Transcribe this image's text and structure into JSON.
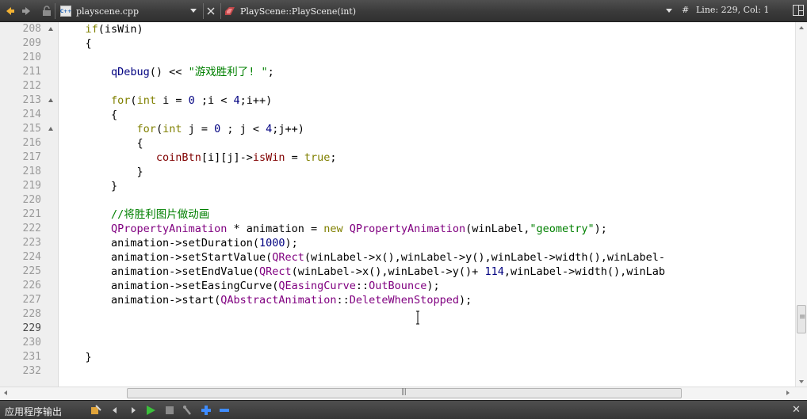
{
  "toolbar": {
    "file_name": "playscene.cpp",
    "file_badge": "C++",
    "symbol_name": "PlayScene::PlayScene(int)",
    "hash": "#",
    "line_col": "Line: 229, Col: 1"
  },
  "editor": {
    "lines": [
      {
        "n": "208",
        "fold": true,
        "html": "    <span class='kw'>if</span><span class='plain'>(isWin)</span>"
      },
      {
        "n": "209",
        "fold": false,
        "html": "    <span class='plain'>{</span>"
      },
      {
        "n": "210",
        "fold": false,
        "html": ""
      },
      {
        "n": "211",
        "fold": false,
        "html": "        qDebug<span class='plain'>() &lt;&lt; </span><span class='str'>\"游戏胜利了! \"</span><span class='plain'>;</span>"
      },
      {
        "n": "212",
        "fold": false,
        "html": ""
      },
      {
        "n": "213",
        "fold": true,
        "html": "        <span class='kw'>for</span><span class='plain'>(</span><span class='kw'>int</span><span class='plain'> i = </span><span class='num'>0</span><span class='plain'> ;i &lt; </span><span class='num'>4</span><span class='plain'>;i++)</span>"
      },
      {
        "n": "214",
        "fold": false,
        "html": "        <span class='plain'>{</span>"
      },
      {
        "n": "215",
        "fold": true,
        "html": "            <span class='kw'>for</span><span class='plain'>(</span><span class='kw'>int</span><span class='plain'> j = </span><span class='num'>0</span><span class='plain'> ; j &lt; </span><span class='num'>4</span><span class='plain'>;j++)</span>"
      },
      {
        "n": "216",
        "fold": false,
        "html": "            <span class='plain'>{</span>"
      },
      {
        "n": "217",
        "fold": false,
        "html": "               <span class='var'>coinBtn</span><span class='plain'>[i][j]-&gt;</span><span class='var'>isWin</span><span class='plain'> = </span><span class='kw'>true</span><span class='plain'>;</span>"
      },
      {
        "n": "218",
        "fold": false,
        "html": "            <span class='plain'>}</span>"
      },
      {
        "n": "219",
        "fold": false,
        "html": "        <span class='plain'>}</span>"
      },
      {
        "n": "220",
        "fold": false,
        "html": ""
      },
      {
        "n": "221",
        "fold": false,
        "html": "        <span class='cm'>//将胜利图片做动画</span>"
      },
      {
        "n": "222",
        "fold": false,
        "html": "        <span class='ty'>QPropertyAnimation</span><span class='plain'> * animation = </span><span class='kw'>new</span> <span class='ty'>QPropertyAnimation</span><span class='plain'>(winLabel,</span><span class='str'>\"geometry\"</span><span class='plain'>);</span>"
      },
      {
        "n": "223",
        "fold": false,
        "html": "        <span class='plain'>animation-&gt;setDuration(</span><span class='num'>1000</span><span class='plain'>);</span>"
      },
      {
        "n": "224",
        "fold": false,
        "html": "        <span class='plain'>animation-&gt;setStartValue(</span><span class='ty'>QRect</span><span class='plain'>(winLabel-&gt;x(),winLabel-&gt;y(),winLabel-&gt;width(),winLabel-</span>"
      },
      {
        "n": "225",
        "fold": false,
        "html": "        <span class='plain'>animation-&gt;setEndValue(</span><span class='ty'>QRect</span><span class='plain'>(winLabel-&gt;x(),winLabel-&gt;y()+ </span><span class='num'>114</span><span class='plain'>,winLabel-&gt;width(),winLab</span>"
      },
      {
        "n": "226",
        "fold": false,
        "html": "        <span class='plain'>animation-&gt;setEasingCurve(</span><span class='ty'>QEasingCurve</span><span class='plain'>::</span><span class='ty'>OutBounce</span><span class='plain'>);</span>"
      },
      {
        "n": "227",
        "fold": false,
        "html": "        <span class='plain'>animation-&gt;start(</span><span class='ty'>QAbstractAnimation</span><span class='plain'>::</span><span class='ty'>DeleteWhenStopped</span><span class='plain'>);</span>"
      },
      {
        "n": "228",
        "fold": false,
        "html": ""
      },
      {
        "n": "229",
        "fold": false,
        "html": "",
        "current": true
      },
      {
        "n": "230",
        "fold": false,
        "html": ""
      },
      {
        "n": "231",
        "fold": false,
        "html": "    <span class='plain'>}</span>"
      },
      {
        "n": "232",
        "fold": false,
        "html": ""
      }
    ]
  },
  "output": {
    "title": "应用程序输出"
  },
  "colors": {
    "keyword": "#808000",
    "type": "#800080",
    "number": "#000080",
    "string": "#008000",
    "member": "#800000"
  }
}
